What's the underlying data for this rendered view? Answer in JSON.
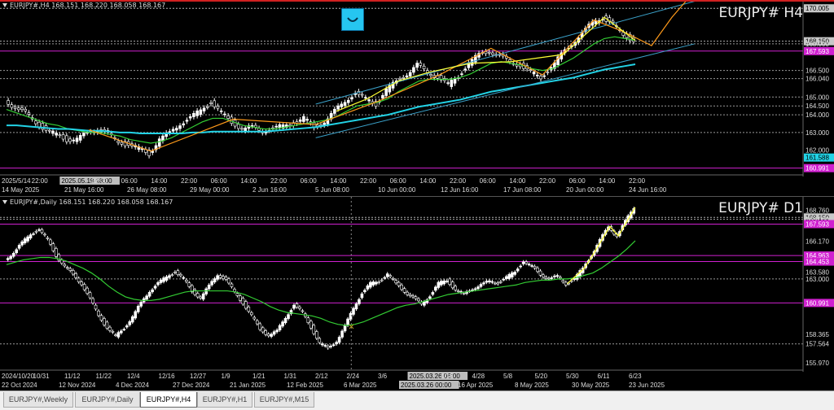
{
  "h4": {
    "title": "EURJPY#,H4  168.151 168.220 168.058 168.167",
    "symbol": "EURJPY# H4",
    "price_labels": [
      {
        "text": "170.005",
        "kind": "grey",
        "v": 170.005
      },
      {
        "text": "168.150",
        "kind": "grey",
        "v": 168.15
      },
      {
        "text": "168.000",
        "kind": "plain",
        "v": 168.0
      },
      {
        "text": "167.593",
        "kind": "magenta",
        "v": 167.593
      },
      {
        "text": "166.500",
        "kind": "plain",
        "v": 166.5
      },
      {
        "text": "166.040",
        "kind": "plain",
        "v": 166.04
      },
      {
        "text": "165.000",
        "kind": "plain",
        "v": 165.0
      },
      {
        "text": "164.500",
        "kind": "plain",
        "v": 164.5
      },
      {
        "text": "164.000",
        "kind": "plain",
        "v": 164.0
      },
      {
        "text": "163.000",
        "kind": "plain",
        "v": 163.0
      },
      {
        "text": "162.000",
        "kind": "plain",
        "v": 162.0
      },
      {
        "text": "161.588",
        "kind": "cyan",
        "v": 161.588
      },
      {
        "text": "160.991",
        "kind": "magenta",
        "v": 160.991
      }
    ],
    "time_labels_top": [
      "2025/5/14",
      "22:00",
      "2025.05.19 18:00",
      "22:00",
      "06:00",
      "14:00",
      "22:00",
      "06:00",
      "14:00",
      "22:00",
      "06:00",
      "14:00",
      "22:00",
      "06:00",
      "14:00",
      "22:00",
      "06:00",
      "14:00",
      "22:00",
      "06:00",
      "14:00",
      "22:00"
    ],
    "time_labels_bottom": [
      "14 May 2025",
      "21 May 16:00",
      "26 May 08:00",
      "29 May 00:00",
      "2 Jun 16:00",
      "5 Jun 08:00",
      "10 Jun 00:00",
      "12 Jun 16:00",
      "17 Jun 08:00",
      "20 Jun 00:00",
      "24 Jun 16:00"
    ]
  },
  "d1": {
    "title": "EURJPY#,Daily  168.151 168.220 168.058 168.167",
    "symbol": "EURJPY# D1",
    "price_labels": [
      {
        "text": "168.760",
        "kind": "plain",
        "v": 168.76
      },
      {
        "text": "168.150",
        "kind": "grey",
        "v": 168.15
      },
      {
        "text": "168.000",
        "kind": "plain",
        "v": 168.0
      },
      {
        "text": "167.593",
        "kind": "magenta",
        "v": 167.593
      },
      {
        "text": "166.170",
        "kind": "plain",
        "v": 166.17
      },
      {
        "text": "164.963",
        "kind": "magenta",
        "v": 164.963
      },
      {
        "text": "164.453",
        "kind": "magenta",
        "v": 164.453
      },
      {
        "text": "163.580",
        "kind": "plain",
        "v": 163.58
      },
      {
        "text": "163.000",
        "kind": "plain",
        "v": 163.0
      },
      {
        "text": "160.991",
        "kind": "magenta",
        "v": 160.991
      },
      {
        "text": "158.365",
        "kind": "plain",
        "v": 158.365
      },
      {
        "text": "157.564",
        "kind": "plain",
        "v": 157.564
      },
      {
        "text": "155.970",
        "kind": "plain",
        "v": 155.97
      }
    ],
    "time_labels_top": [
      "2024/10/20",
      "10/31",
      "11/12",
      "11/22",
      "12/4",
      "12/16",
      "12/27",
      "1/9",
      "1/21",
      "1/31",
      "2/12",
      "2/24",
      "3/6",
      "2025.03.26 06:00",
      "4/16",
      "4/28",
      "5/8",
      "5/20",
      "5/30",
      "6/11",
      "6/23"
    ],
    "time_labels_bottom": [
      "22 Oct 2024",
      "12 Nov 2024",
      "4 Dec 2024",
      "27 Dec 2024",
      "21 Jan 2025",
      "12 Feb 2025",
      "6 Mar 2025",
      "2025.03.26 00:00",
      "16 Apr 2025",
      "8 May 2025",
      "30 May 2025",
      "23 Jun 2025"
    ]
  },
  "tabs": [
    {
      "label": "EURJPY#,Weekly",
      "active": false
    },
    {
      "label": "EURJPY#,Daily",
      "active": false
    },
    {
      "label": "EURJPY#,H4",
      "active": true
    },
    {
      "label": "EURJPY#,H1",
      "active": false
    },
    {
      "label": "EURJPY#,M15",
      "active": false
    }
  ],
  "colors": {
    "bg": "#000000",
    "candle": "#ffffff",
    "ma_green": "#33cc33",
    "ma_cyan": "#22d3e6",
    "ma_orange": "#ff9a1a",
    "hline_magenta": "#d020d0",
    "hline_grey": "#b0b0b0",
    "zigzag": "#ffff33",
    "channel": "#3aa0c8"
  },
  "chart_data": [
    {
      "type": "line",
      "title": "EURJPY# H4",
      "ylim": [
        160.7,
        170.2
      ],
      "series": [
        {
          "values": [
            164.8,
            164.4,
            164.1,
            163.6,
            163.1,
            162.9,
            162.6,
            162.6,
            163.0,
            163.2,
            162.9,
            162.5,
            162.3,
            162.1,
            161.8,
            162.6,
            163.0,
            163.5,
            163.8,
            164.3,
            164.7,
            164.1,
            163.6,
            163.2,
            163.3,
            163.1,
            163.2,
            163.4,
            163.5,
            163.8,
            163.3,
            163.6,
            164.2,
            164.8,
            165.2,
            164.9,
            164.6,
            165.4,
            165.9,
            166.3,
            166.8,
            166.4,
            166.1,
            165.7,
            166.2,
            166.9,
            167.4,
            167.6,
            167.3,
            167.0,
            166.8,
            166.4,
            166.1,
            166.7,
            167.4,
            168.0,
            168.6,
            169.2,
            169.5,
            169.1,
            168.5,
            168.2
          ]
        },
        {
          "values": [
            164.3,
            164.1,
            163.9,
            163.7,
            163.5,
            163.4,
            163.2,
            163.1,
            163.0,
            163.0,
            162.9,
            162.8,
            162.6,
            162.5,
            162.4,
            162.5,
            162.7,
            163.0,
            163.3,
            163.6,
            163.8,
            163.8,
            163.6,
            163.4,
            163.3,
            163.2,
            163.2,
            163.3,
            163.4,
            163.5,
            163.6,
            163.7,
            163.9,
            164.2,
            164.5,
            164.6,
            164.7,
            164.9,
            165.3,
            165.6,
            165.9,
            166.0,
            166.0,
            166.0,
            166.1,
            166.3,
            166.6,
            166.9,
            167.0,
            166.9,
            166.8,
            166.6,
            166.5,
            166.6,
            166.9,
            167.2,
            167.6,
            168.0,
            168.3,
            168.4,
            168.3,
            168.2
          ]
        },
        {
          "values": [
            163.4,
            163.4,
            163.35,
            163.3,
            163.25,
            163.2,
            163.2,
            163.15,
            163.1,
            163.1,
            163.05,
            163.0,
            163.0,
            162.95,
            162.95,
            162.95,
            162.95,
            162.95,
            163.0,
            163.0,
            163.05,
            163.05,
            163.05,
            163.05,
            163.05,
            163.05,
            163.1,
            163.15,
            163.2,
            163.25,
            163.3,
            163.4,
            163.5,
            163.6,
            163.7,
            163.8,
            163.9,
            164.0,
            164.15,
            164.3,
            164.45,
            164.55,
            164.65,
            164.75,
            164.85,
            165.0,
            165.15,
            165.3,
            165.4,
            165.5,
            165.6,
            165.7,
            165.8,
            165.9,
            166.0,
            166.1,
            166.25,
            166.4,
            166.55,
            166.65,
            166.75,
            166.85
          ]
        }
      ]
    },
    {
      "type": "line",
      "title": "EURJPY# D1",
      "ylim": [
        155.5,
        169.6
      ],
      "series": [
        {
          "values": [
            164.6,
            165.2,
            166.0,
            166.8,
            167.1,
            166.3,
            165.0,
            164.0,
            163.4,
            162.6,
            161.3,
            160.0,
            158.9,
            158.2,
            158.9,
            159.8,
            161.0,
            162.0,
            162.6,
            163.2,
            163.6,
            163.0,
            162.0,
            161.4,
            162.4,
            163.4,
            162.9,
            161.9,
            161.0,
            159.9,
            158.8,
            158.3,
            158.6,
            159.8,
            160.8,
            160.2,
            159.0,
            157.6,
            157.2,
            157.8,
            159.0,
            160.6,
            161.8,
            162.6,
            162.8,
            163.4,
            162.6,
            162.0,
            161.4,
            160.9,
            161.6,
            162.6,
            162.9,
            162.1,
            161.7,
            162.2,
            162.5,
            162.8,
            162.7,
            163.1,
            163.6,
            164.5,
            164.0,
            163.4,
            163.0,
            163.2,
            162.6,
            163.0,
            163.9,
            165.0,
            166.2,
            167.4,
            166.6,
            167.8,
            169.0
          ]
        },
        {
          "values": [
            164.2,
            164.4,
            164.6,
            164.7,
            164.8,
            164.8,
            164.7,
            164.5,
            164.2,
            163.9,
            163.5,
            163.0,
            162.4,
            161.9,
            161.5,
            161.3,
            161.2,
            161.2,
            161.3,
            161.5,
            161.7,
            161.9,
            162.0,
            162.0,
            162.0,
            162.0,
            162.0,
            161.9,
            161.7,
            161.4,
            161.1,
            160.7,
            160.4,
            160.2,
            160.1,
            160.0,
            159.9,
            159.7,
            159.4,
            159.2,
            159.1,
            159.2,
            159.4,
            159.7,
            160.0,
            160.3,
            160.6,
            160.8,
            160.9,
            161.1,
            161.3,
            161.5,
            161.7,
            161.8,
            161.9,
            162.0,
            162.1,
            162.2,
            162.3,
            162.4,
            162.5,
            162.7,
            162.8,
            162.9,
            162.9,
            163.0,
            163.0,
            163.1,
            163.3,
            163.5,
            163.9,
            164.4,
            164.9,
            165.5,
            166.2
          ]
        }
      ]
    }
  ]
}
